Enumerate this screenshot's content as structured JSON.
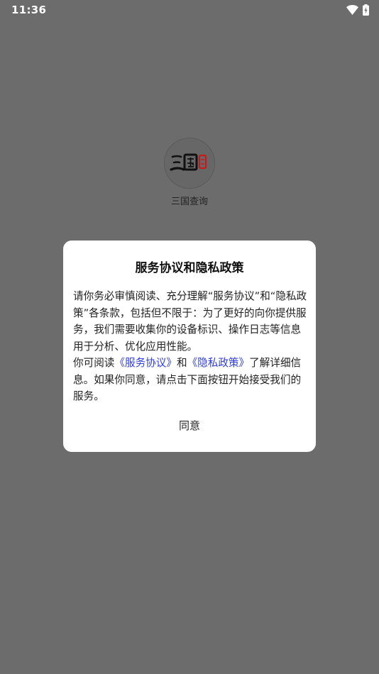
{
  "status_bar": {
    "time": "11:36",
    "icons": [
      "wifi-icon",
      "battery-charging-icon"
    ]
  },
  "splash": {
    "app_name": "三国查询",
    "logo_icon": "sanguo-calligraphy-logo"
  },
  "dialog": {
    "title": "服务协议和隐私政策",
    "body_text": "请你务必审慎阅读、充分理解“服务协议”和“隐私政策”各条款，包括但不限于：为了更好的向你提供服务，我们需要收集你的设备标识、操作日志等信息用于分析、优化应用性能。",
    "read_prefix": "你可阅读",
    "link_service": "《服务协议》",
    "joiner": "和",
    "link_privacy": "《隐私政策》",
    "read_suffix": "了解详细信息。如果你同意，请点击下面按钮开始接受我们的服务。",
    "agree_label": "同意"
  },
  "colors": {
    "overlay": "#6c6c6c",
    "dialog_bg": "#ffffff",
    "link": "#2f3edc",
    "text": "#222222"
  }
}
